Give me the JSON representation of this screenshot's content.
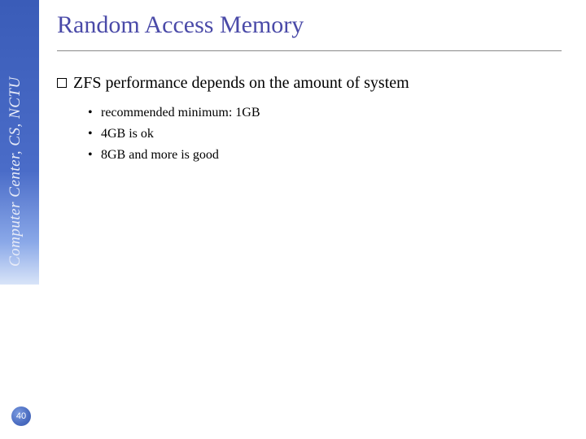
{
  "sidebar": {
    "label": "Computer Center, CS, NCTU"
  },
  "page_number": "40",
  "title": "Random Access Memory",
  "main_bullet": "ZFS performance depends on the amount of system",
  "sub_bullets": [
    "recommended minimum: 1GB",
    "4GB is ok",
    "8GB and more is good"
  ]
}
